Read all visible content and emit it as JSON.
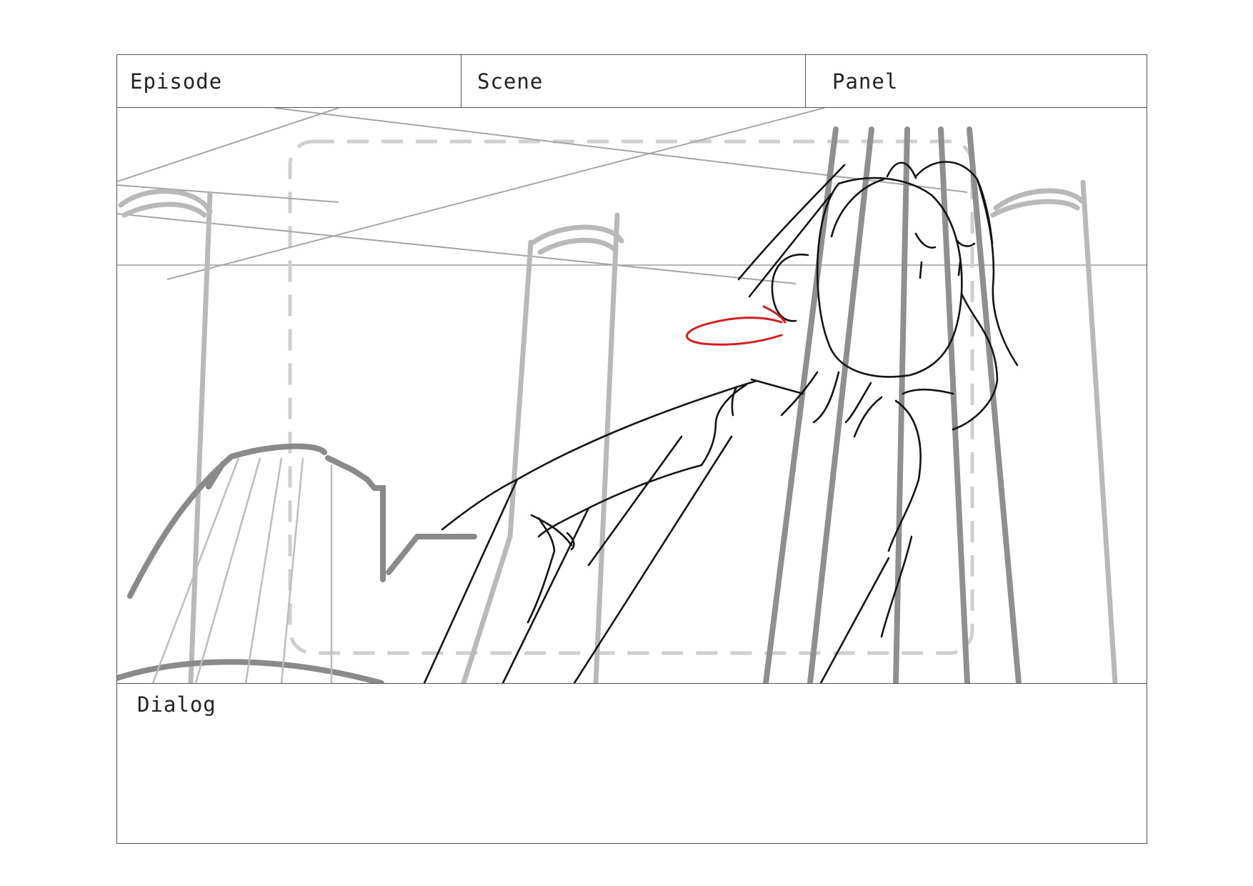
{
  "storyboard": {
    "header": {
      "episode_label": "Episode",
      "scene_label": "Scene",
      "panel_label": "Panel"
    },
    "dialog": {
      "label": "Dialog"
    },
    "sketch": {
      "description_colors": {
        "guide_gray": "#bdbdbd",
        "column_gray": "#8c8c8c",
        "ink_black": "#111111",
        "accent_red": "#d21f1f"
      }
    }
  }
}
